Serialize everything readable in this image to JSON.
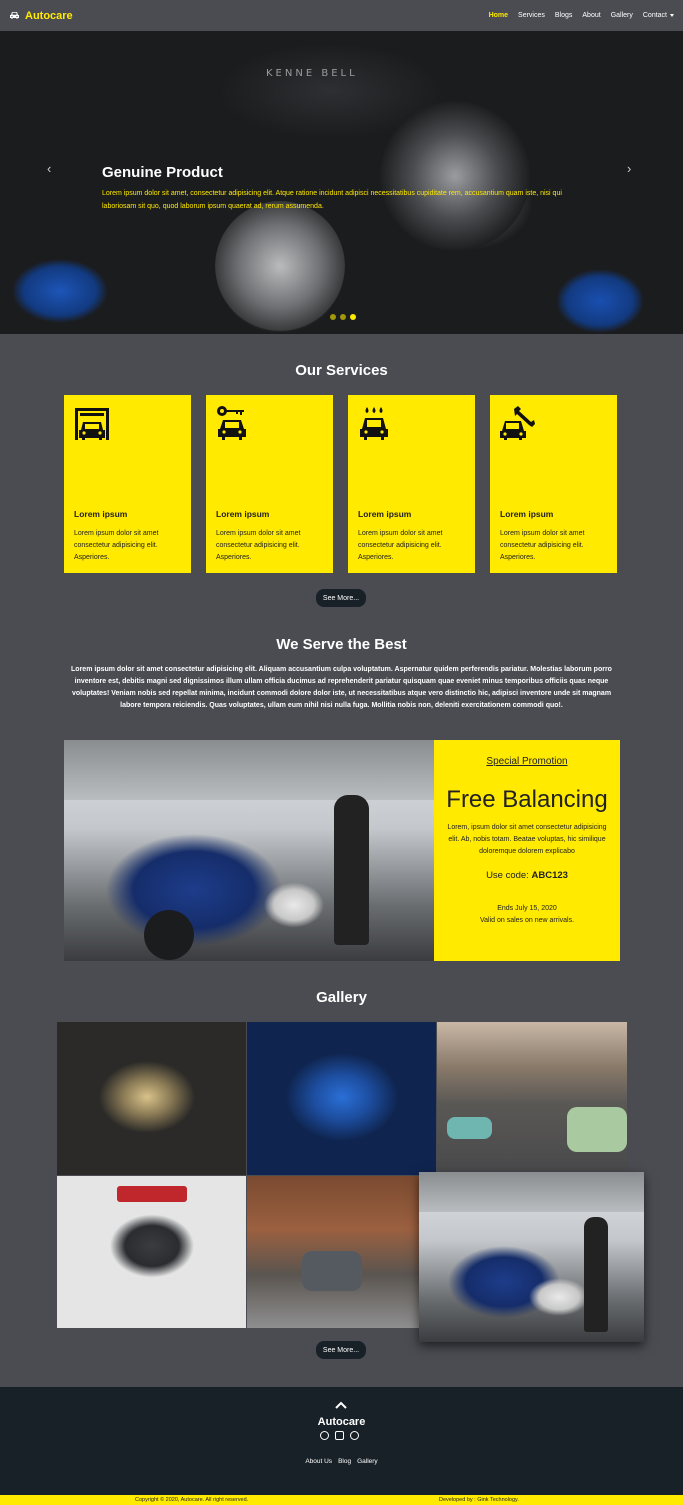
{
  "navbar": {
    "brand": "Autocare",
    "links": [
      "Home",
      "Services",
      "Blogs",
      "About",
      "Gallery",
      "Contact"
    ]
  },
  "hero": {
    "image_text": "KENNE BELL",
    "title": "Genuine Product",
    "text": "Lorem ipsum dolor sit amet, consectetur adipisicing elit. Atque ratione incidunt adipisci necessitatibus cupiditate rem, accusantium quam iste, nisi qui laboriosam sit quo, quod laborum ipsum quaerat ad, rerum assumenda.",
    "prev": "‹",
    "next": "›"
  },
  "services": {
    "title": "Our Services",
    "cards": [
      {
        "icon": "garage-car-icon",
        "title": "Lorem ipsum",
        "text": "Lorem ipsum dolor sit amet consectetur adipisicing elit. Asperiores."
      },
      {
        "icon": "car-key-icon",
        "title": "Lorem ipsum",
        "text": "Lorem ipsum dolor sit amet consectetur adipisicing elit. Asperiores."
      },
      {
        "icon": "car-wash-icon",
        "title": "Lorem ipsum",
        "text": "Lorem ipsum dolor sit amet consectetur adipisicing elit. Asperiores."
      },
      {
        "icon": "car-repair-icon",
        "title": "Lorem ipsum",
        "text": "Lorem ipsum dolor sit amet consectetur adipisicing elit. Asperiores."
      }
    ],
    "button": "See More..."
  },
  "serve": {
    "title": "We Serve the Best",
    "text": "Lorem ipsum dolor sit amet consectetur adipisicing elit. Aliquam accusantium culpa voluptatum. Aspernatur quidem perferendis pariatur. Molestias laborum porro inventore est, debitis magni sed dignissimos illum ullam officia ducimus ad reprehenderit pariatur quisquam quae eveniet minus temporibus officiis quas neque voluptates! Veniam nobis sed repellat minima, incidunt commodi dolore dolor iste, ut necessitatibus atque vero distinctio hic, adipisci inventore unde sit magnam labore tempora reiciendis. Quas voluptates, ullam eum nihil nisi nulla fuga. Mollitia nobis non, deleniti exercitationem commodi quo!."
  },
  "promo": {
    "label": "Special Promotion",
    "headline": "Free Balancing",
    "text": "Lorem, ipsum dolor sit amet consectetur adipisicing elit. Ab, nobis totam. Beatae voluptas, hic similique doloremque dolorem explicabo",
    "code_label": "Use code:",
    "code": "ABC123",
    "ends": "Ends July 15, 2020",
    "valid": "Valid on sales on new arrivals."
  },
  "gallery": {
    "title": "Gallery",
    "button": "See More..."
  },
  "footer": {
    "brand": "Autocare",
    "links": [
      "About Us",
      "Blog",
      "Gallery"
    ],
    "copyright": "Copyright © 2020, Autocare. All right reserved.",
    "developer": "Developed by : Gink Technology."
  },
  "colors": {
    "accent": "#ffea00",
    "background": "#4a4c52",
    "footer": "#182128"
  }
}
